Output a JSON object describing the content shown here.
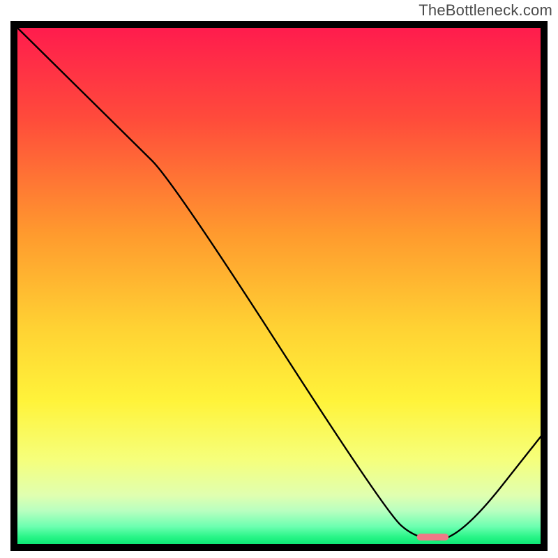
{
  "attribution": "TheBottleneck.com",
  "chart_data": {
    "type": "line",
    "title": "",
    "xlabel": "",
    "ylabel": "",
    "xlim": [
      0,
      100
    ],
    "ylim": [
      0,
      100
    ],
    "gradient_stops": [
      {
        "offset": 0,
        "color": "#ff1a4e"
      },
      {
        "offset": 18,
        "color": "#ff4b3b"
      },
      {
        "offset": 40,
        "color": "#ff9a2e"
      },
      {
        "offset": 58,
        "color": "#ffd233"
      },
      {
        "offset": 72,
        "color": "#fff33a"
      },
      {
        "offset": 83,
        "color": "#f6ff7a"
      },
      {
        "offset": 90,
        "color": "#e0ffb0"
      },
      {
        "offset": 93,
        "color": "#b8ffc0"
      },
      {
        "offset": 96,
        "color": "#6cffb0"
      },
      {
        "offset": 98,
        "color": "#28f587"
      },
      {
        "offset": 100,
        "color": "#00e46c"
      }
    ],
    "marker": {
      "x": 79,
      "y": 2,
      "w": 6,
      "h": 1.3,
      "color": "#ee7a87"
    },
    "series": [
      {
        "name": "bottleneck-curve",
        "color": "#000000",
        "points": [
          {
            "x": 0,
            "y": 100
          },
          {
            "x": 22,
            "y": 78
          },
          {
            "x": 30,
            "y": 70
          },
          {
            "x": 70,
            "y": 7
          },
          {
            "x": 76,
            "y": 1.5
          },
          {
            "x": 84,
            "y": 1.5
          },
          {
            "x": 100,
            "y": 22
          }
        ]
      }
    ]
  }
}
